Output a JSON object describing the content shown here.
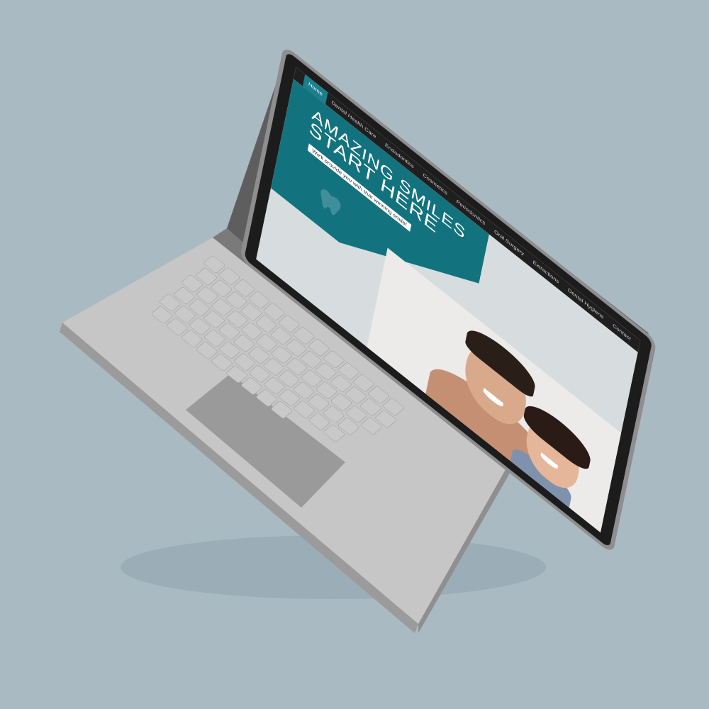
{
  "site": {
    "nav": [
      {
        "label": "Home",
        "active": true
      },
      {
        "label": "Dental Health Care"
      },
      {
        "label": "Endodontics"
      },
      {
        "label": "Cosmetics"
      },
      {
        "label": "Periodontics"
      },
      {
        "label": "Oral Surgery"
      },
      {
        "label": "Extractions"
      },
      {
        "label": "Dental Hygiene"
      },
      {
        "label": "Contact"
      }
    ],
    "hero": {
      "title_line1": "AMAZING SMILES",
      "title_line2": "START HERE",
      "subtitle": "We'll provide you with that winning smile!"
    },
    "icons": {
      "logo": "tooth-icon"
    },
    "colors": {
      "accent": "#12737f",
      "nav_bg": "#1f1f1f",
      "background": "#a9bac2"
    }
  }
}
